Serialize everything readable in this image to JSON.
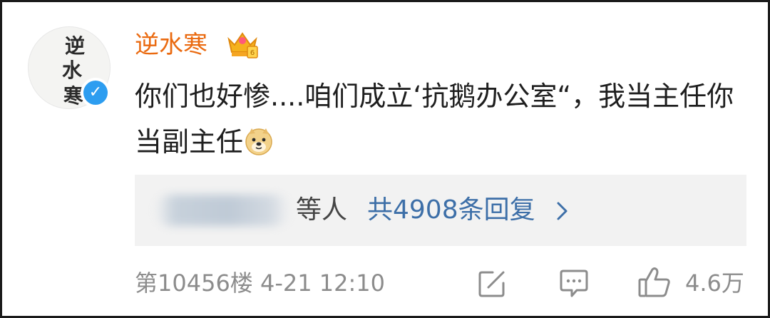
{
  "comment": {
    "username": "逆水寒",
    "username_color": "#ea6a10",
    "avatar_text": [
      "逆",
      "水",
      "寒"
    ],
    "verified_icon": "verified-badge-icon",
    "vip_icon": "crown-badge-icon",
    "content_text": "你们也好惨....咱们成立‘抗鹅办公室“，我当主任你当副主任",
    "emoji": "doge-emoji-icon"
  },
  "replies": {
    "people_suffix": "等人",
    "count_text": "共4908条回复",
    "link_color": "#3d6fa8"
  },
  "meta": {
    "floor_time": "第10456楼 4-21 12:10",
    "likes": "4.6万"
  }
}
